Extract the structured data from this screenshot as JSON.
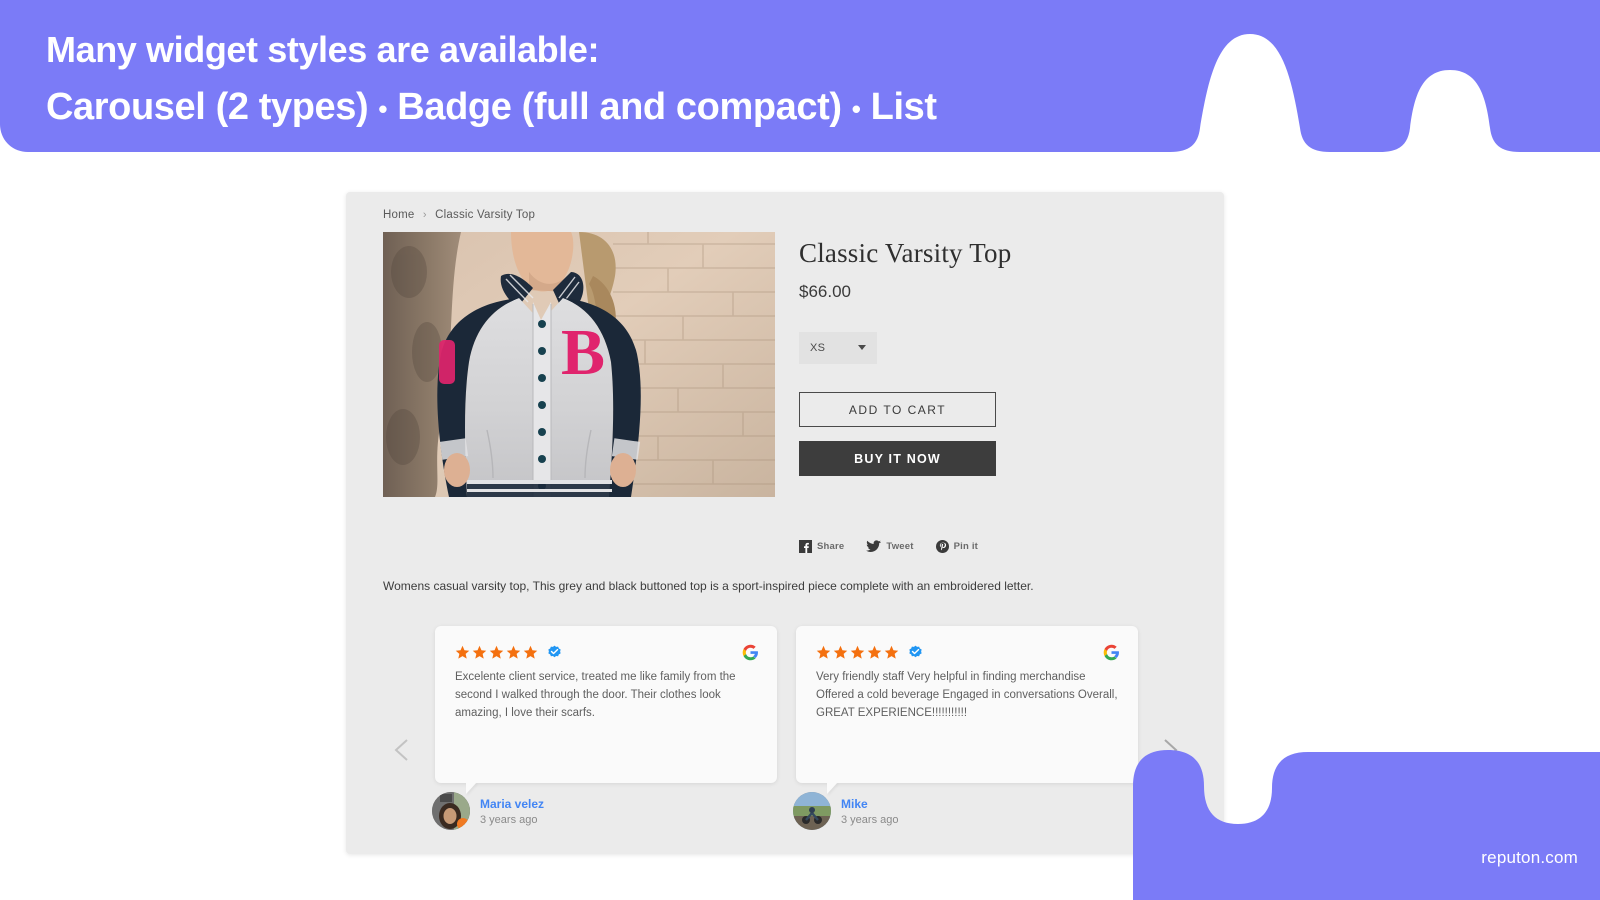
{
  "banner": {
    "line1": "Many widget styles are available:",
    "line2_a": "Carousel (2 types)",
    "line2_dot1": "•",
    "line2_b": "Badge (full and compact)",
    "line2_dot2": "•",
    "line2_c": "List",
    "bg_color": "#7b7bf7"
  },
  "shop": {
    "breadcrumb": {
      "home": "Home",
      "separator": "›",
      "current": "Classic Varsity Top"
    },
    "product": {
      "image_alt": "Woman wearing grey and navy varsity jacket with pink letter B against a brick wall",
      "title": "Classic Varsity Top",
      "price": "$66.00",
      "size_value": "XS",
      "add_to_cart_label": "ADD TO CART",
      "buy_now_label": "BUY IT NOW",
      "description": "Womens casual varsity top, This grey and black buttoned top is a sport-inspired piece complete with an embroidered letter."
    },
    "social": [
      {
        "icon": "facebook-icon",
        "label": "Share"
      },
      {
        "icon": "twitter-icon",
        "label": "Tweet"
      },
      {
        "icon": "pinterest-icon",
        "label": "Pin it"
      }
    ]
  },
  "carousel": {
    "prev_label": "Previous review",
    "next_label": "Next review",
    "star_color": "#f4700f",
    "verified_color": "#2196f3",
    "reviews": [
      {
        "rating": 5,
        "source": "google",
        "verified": true,
        "text": "Excelente client service, treated me like family from the second I walked through the door. Their clothes look amazing, I love their scarfs.",
        "author": "Maria velez",
        "time": "3 years ago"
      },
      {
        "rating": 5,
        "source": "google",
        "verified": true,
        "text": "Very friendly staff Very helpful in finding merchandise Offered a cold beverage Engaged in conversations Overall, GREAT EXPERIENCE!!!!!!!!!!!",
        "author": "Mike",
        "time": "3 years ago"
      }
    ]
  },
  "footer": {
    "brand": "reputon.com",
    "bg_color": "#7b7bf7"
  }
}
